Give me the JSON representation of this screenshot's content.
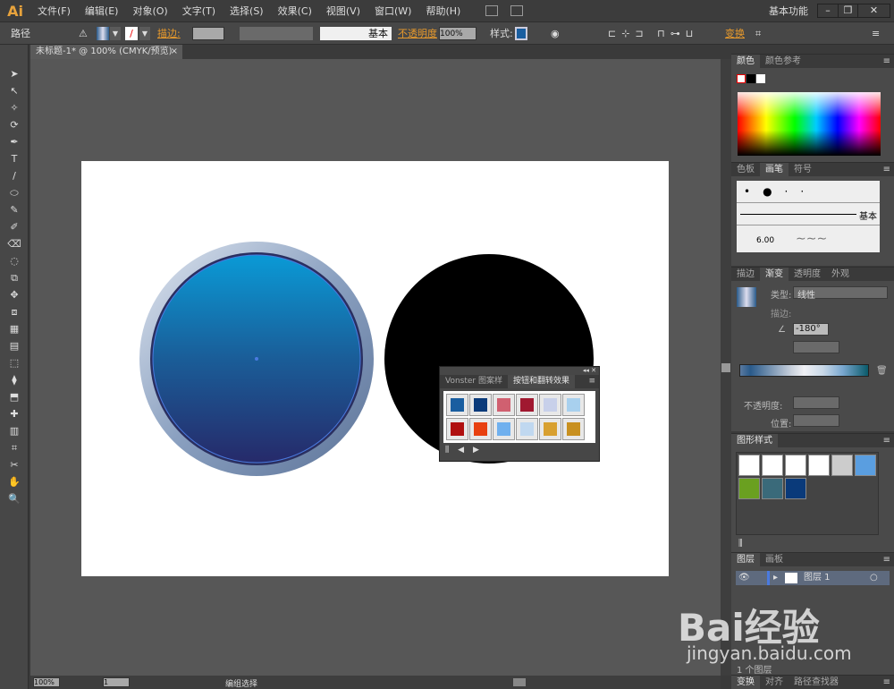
{
  "app": {
    "logo": "Ai",
    "workspace": "基本功能"
  },
  "menu": [
    "文件(F)",
    "编辑(E)",
    "对象(O)",
    "文字(T)",
    "选择(S)",
    "效果(C)",
    "视图(V)",
    "窗口(W)",
    "帮助(H)"
  ],
  "control": {
    "selection": "路径",
    "stroke_label": "描边:",
    "stroke_profile": "基本",
    "opacity_label": "不透明度",
    "opacity": "100%",
    "style_label": "样式:",
    "transform": "变换"
  },
  "document": {
    "tab": "未标题-1* @ 100% (CMYK/预览)",
    "close": "×"
  },
  "floating_panel": {
    "tabs": [
      "Vonster 图案样",
      "按钮和翻转效果"
    ],
    "active": 1
  },
  "color_panel": {
    "tabs": [
      "颜色",
      "颜色参考"
    ]
  },
  "brush_panel": {
    "tabs": [
      "色板",
      "画笔",
      "符号"
    ],
    "basic": "基本",
    "size": "6.00"
  },
  "gradient_panel": {
    "tabs": [
      "描边",
      "渐变",
      "透明度",
      "外观"
    ],
    "type_label": "类型:",
    "type": "线性",
    "stroke_label": "描边:",
    "angle": "-180°",
    "opacity_label": "不透明度:",
    "position_label": "位置:"
  },
  "styles_panel": {
    "tabs": [
      "图形样式"
    ]
  },
  "layers_panel": {
    "tabs": [
      "图层",
      "画板"
    ],
    "layer": "图层 1",
    "count": "1 个图层"
  },
  "bottom_panel": {
    "tabs": [
      "变换",
      "对齐",
      "路径查找器"
    ]
  },
  "status": {
    "zoom": "100%",
    "page": "1",
    "tool": "编组选择"
  },
  "watermark": {
    "text": "Bai经验",
    "url": "jingyan.baidu.com"
  },
  "colors": {
    "accent": "#e89a2c",
    "circle_top": "#0a9ad6",
    "circle_bottom": "#262a6a"
  }
}
